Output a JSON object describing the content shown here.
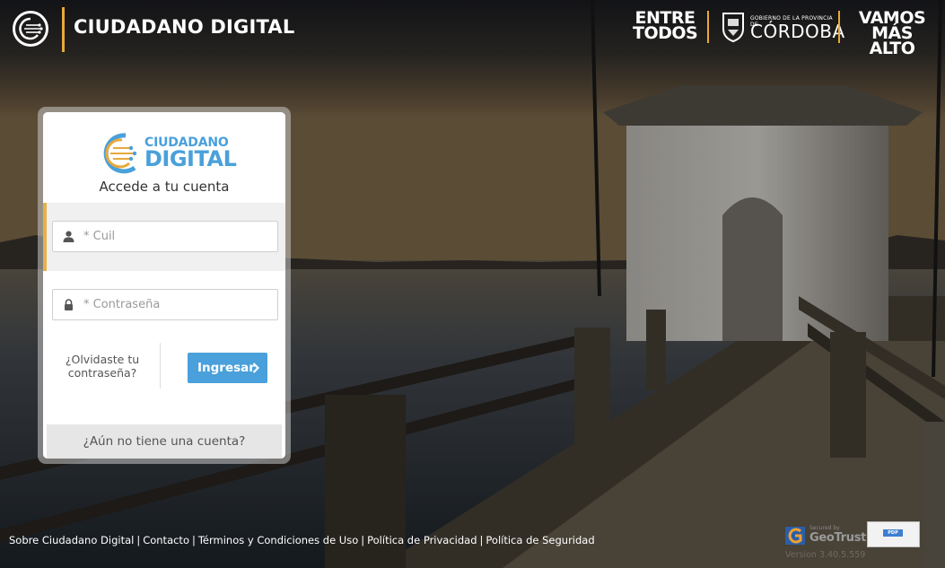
{
  "header": {
    "title": "CIUDADANO DIGITAL",
    "brand_left_line1": "ENTRE",
    "brand_left_line2": "TODOS",
    "brand_gov_small": "GOBIERNO DE LA PROVINCIA DE",
    "brand_gov_big": "CÓRDOBA",
    "brand_right_line1": "VAMOS",
    "brand_right_line2": "MÁS ALTO"
  },
  "login": {
    "logo_top": "CIUDADANO",
    "logo_bottom": "DIGITAL",
    "subtitle": "Accede a tu cuenta",
    "cuil_placeholder": "* Cuil",
    "password_placeholder": "* Contraseña",
    "forgot_line1": "¿Olvidaste tu",
    "forgot_line2": "contraseña?",
    "submit_label": "Ingresar",
    "register_label": "¿Aún no tiene una cuenta?"
  },
  "footer": {
    "links": [
      "Sobre Ciudadano Digital",
      "Contacto",
      "Términos y Condiciones de Uso",
      "Política de Privacidad",
      "Política de Seguridad"
    ],
    "separator": "|",
    "geotrust_small": "Secured by",
    "geotrust_big": "GeoTrust",
    "pdp_label": "PDP",
    "version": "Version 3.40.5.559"
  },
  "colors": {
    "accent_blue": "#4aa0da",
    "accent_gold": "#e8a93b",
    "field_band": "#f0f0f0"
  },
  "icons": [
    "circuit-logo-icon",
    "user-icon",
    "lock-icon",
    "chevron-right-icon",
    "shield-icon"
  ]
}
